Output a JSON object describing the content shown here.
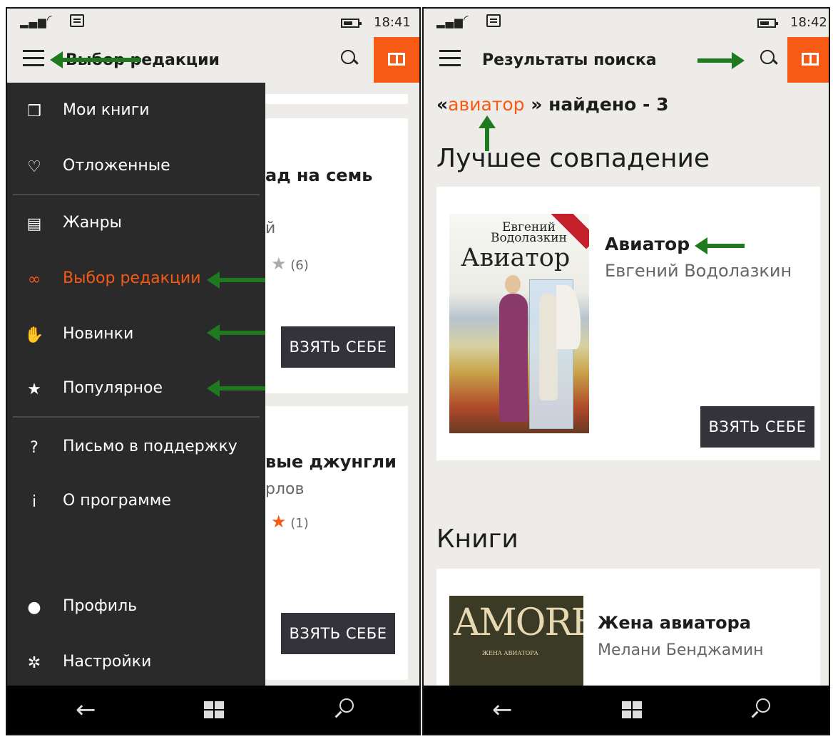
{
  "colors": {
    "accent": "#f65a14",
    "arrow": "#1f7a1f",
    "drawer_bg": "#2a2a2a",
    "button_bg": "#34323a"
  },
  "left": {
    "status": {
      "time": "18:41"
    },
    "appbar": {
      "title": "Выбор редакции"
    },
    "background_cards": [
      {
        "title_fragment": "ад на семь",
        "author_fragment": "й",
        "rating": "(6)",
        "button": "ВЗЯТЬ СЕБЕ"
      },
      {
        "title_fragment": "вые джунгли",
        "author_fragment": "рлов",
        "rating": "(1)",
        "button": "ВЗЯТЬ СЕБЕ"
      }
    ],
    "menu": [
      {
        "icon": "book-icon",
        "label": "Мои книги"
      },
      {
        "icon": "heart-icon",
        "label": "Отложенные"
      },
      {
        "icon": "genres-icon",
        "label": "Жанры"
      },
      {
        "icon": "glasses-icon",
        "label": "Выбор редакции",
        "active": true
      },
      {
        "icon": "thumbs-up-icon",
        "label": "Новинки"
      },
      {
        "icon": "star-icon",
        "label": "Популярное"
      },
      {
        "icon": "question-icon",
        "label": "Письмо в поддержку"
      },
      {
        "icon": "info-icon",
        "label": "О программе"
      },
      {
        "icon": "person-icon",
        "label": "Профиль"
      },
      {
        "icon": "gear-icon",
        "label": "Настройки"
      }
    ]
  },
  "right": {
    "status": {
      "time": "18:42"
    },
    "appbar": {
      "title": "Результаты поиска"
    },
    "query": {
      "open": "«",
      "term": "авиатор",
      "close": " » найдено - 3"
    },
    "best_match": {
      "heading": "Лучшее совпадение",
      "cover_author": "Евгений\nВодолазкин",
      "cover_title": "Авиатор",
      "title": "Авиатор",
      "author": "Евгений Водолазкин",
      "button": "ВЗЯТЬ СЕБЕ"
    },
    "books": {
      "heading": "Книги",
      "items": [
        {
          "cover_big": "AMORE",
          "cover_small": "ЖЕНА АВИАТОРА",
          "title": "Жена авиатора",
          "author": "Мелани Бенджамин"
        }
      ]
    }
  }
}
